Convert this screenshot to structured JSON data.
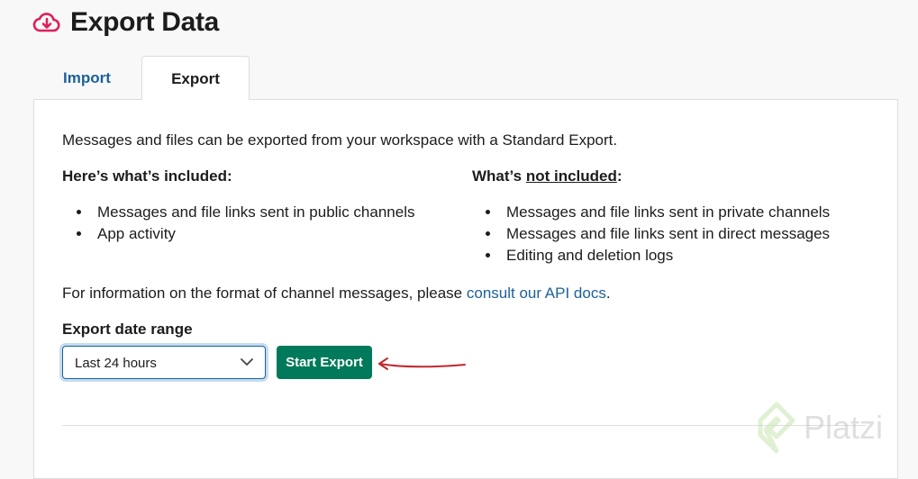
{
  "header": {
    "title": "Export Data",
    "icon": "cloud-download-icon",
    "icon_color": "#e01e5a"
  },
  "tabs": [
    {
      "label": "Import"
    },
    {
      "label": "Export",
      "active": true
    }
  ],
  "export": {
    "intro": "Messages and files can be exported from your workspace with a Standard Export.",
    "included": {
      "heading": "Here’s what’s included:",
      "items": [
        "Messages and file links sent in public channels",
        "App activity"
      ]
    },
    "not_included": {
      "heading_prefix": "What’s ",
      "heading_underlined": "not included",
      "heading_suffix": ":",
      "items": [
        "Messages and file links sent in private channels",
        "Messages and file links sent in direct messages",
        "Editing and deletion logs"
      ]
    },
    "api_note": {
      "prefix": "For information on the format of channel messages, please ",
      "link": "consult our API docs",
      "suffix": "."
    },
    "date_range": {
      "label": "Export date range",
      "selected": "Last 24 hours"
    },
    "start_button": "Start Export"
  },
  "watermark": {
    "text": "Platzi"
  },
  "colors": {
    "link": "#1d6198",
    "button": "#007a5a",
    "annotation": "#c0282d"
  }
}
